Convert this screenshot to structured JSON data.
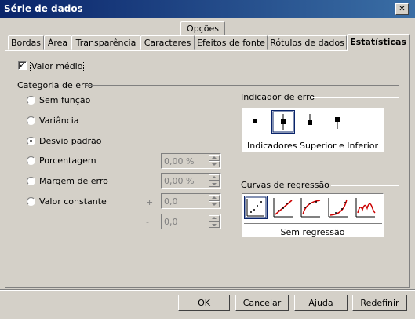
{
  "window": {
    "title": "Série de dados",
    "close": "✕"
  },
  "tabs_top": {
    "options": "Opções"
  },
  "tabs": [
    {
      "label": "Bordas"
    },
    {
      "label": "Área"
    },
    {
      "label": "Transparência"
    },
    {
      "label": "Caracteres"
    },
    {
      "label": "Efeitos de fonte"
    },
    {
      "label": "Rótulos de dados"
    },
    {
      "label": "Estatísticas"
    }
  ],
  "mean": {
    "label": "Valor médio",
    "checked": true
  },
  "error_category": {
    "title": "Categoria de erro",
    "options": [
      {
        "label": "Sem função",
        "selected": false
      },
      {
        "label": "Variância",
        "selected": false
      },
      {
        "label": "Desvio padrão",
        "selected": true
      },
      {
        "label": "Porcentagem",
        "selected": false
      },
      {
        "label": "Margem de erro",
        "selected": false
      },
      {
        "label": "Valor constante",
        "selected": false
      }
    ],
    "percent_value": "0,00 %",
    "margin_value": "0,00 %",
    "plus_sign": "+",
    "minus_sign": "-",
    "const_plus_value": "0,0",
    "const_minus_value": "0,0"
  },
  "error_indicator": {
    "title": "Indicador de erro",
    "selected_caption": "Indicadores Superior e Inferior"
  },
  "regression": {
    "title": "Curvas de regressão",
    "selected_caption": "Sem regressão"
  },
  "buttons": {
    "ok": "OK",
    "cancel": "Cancelar",
    "help": "Ajuda",
    "reset": "Redefinir"
  }
}
